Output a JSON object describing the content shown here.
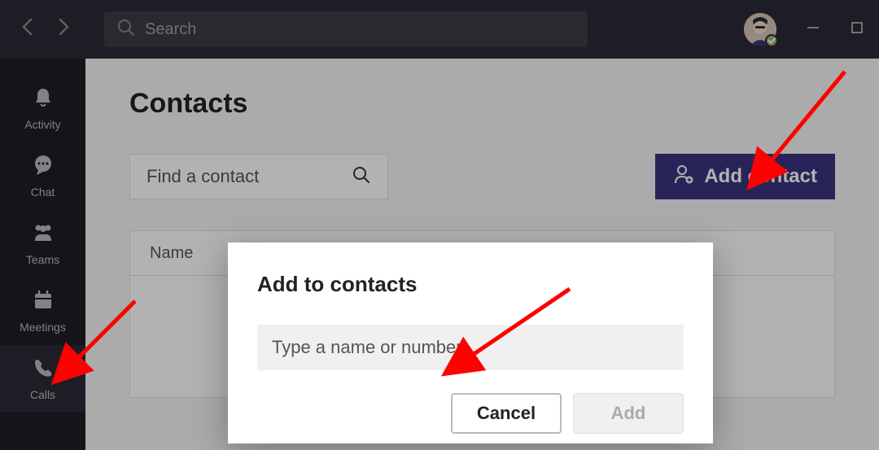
{
  "titlebar": {
    "search_placeholder": "Search"
  },
  "sidebar": {
    "items": [
      {
        "label": "Activity"
      },
      {
        "label": "Chat"
      },
      {
        "label": "Teams"
      },
      {
        "label": "Meetings"
      },
      {
        "label": "Calls"
      }
    ]
  },
  "main": {
    "page_title": "Contacts",
    "find_contact_placeholder": "Find a contact",
    "add_contact_label": "Add contact",
    "table": {
      "column_name": "Name"
    }
  },
  "modal": {
    "title": "Add to contacts",
    "input_placeholder": "Type a name or number",
    "cancel_label": "Cancel",
    "add_label": "Add"
  }
}
